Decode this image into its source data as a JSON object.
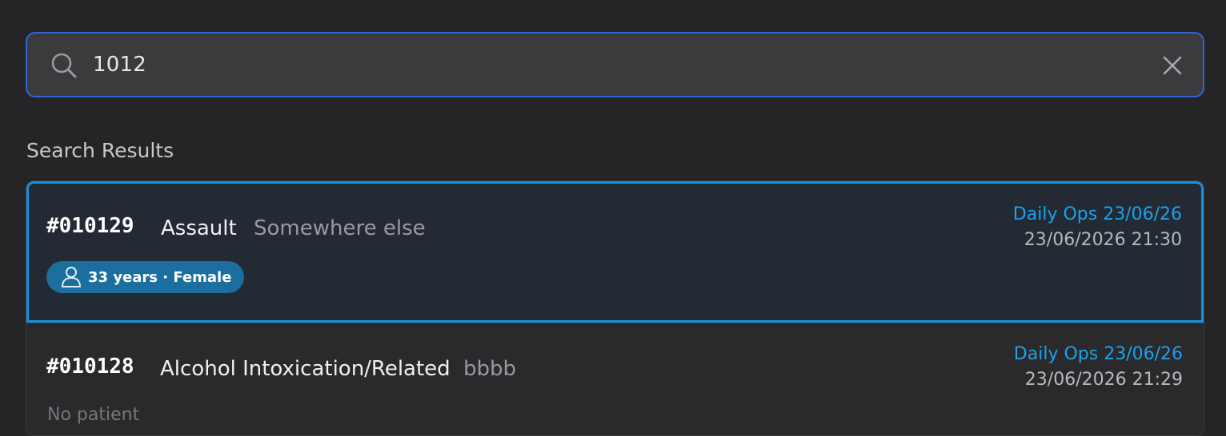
{
  "search": {
    "value": "1012",
    "icon": "search-icon",
    "clear_icon": "close-icon"
  },
  "results_heading": "Search Results",
  "results": [
    {
      "id": "#010129",
      "type": "Assault",
      "location": "Somewhere else",
      "ops": "Daily Ops 23/06/26",
      "time": "23/06/2026 21:30",
      "patient": "33 years · Female",
      "selected": true
    },
    {
      "id": "#010128",
      "type": "Alcohol Intoxication/Related",
      "location": "bbbb",
      "ops": "Daily Ops 23/06/26",
      "time": "23/06/2026 21:29",
      "patient": "No patient",
      "selected": false
    }
  ],
  "colors": {
    "background": "#252527",
    "search_border": "#2f63d6",
    "selected_border": "#1593e0",
    "ops_text": "#1ea0ea",
    "badge": "#1c6e9e"
  }
}
